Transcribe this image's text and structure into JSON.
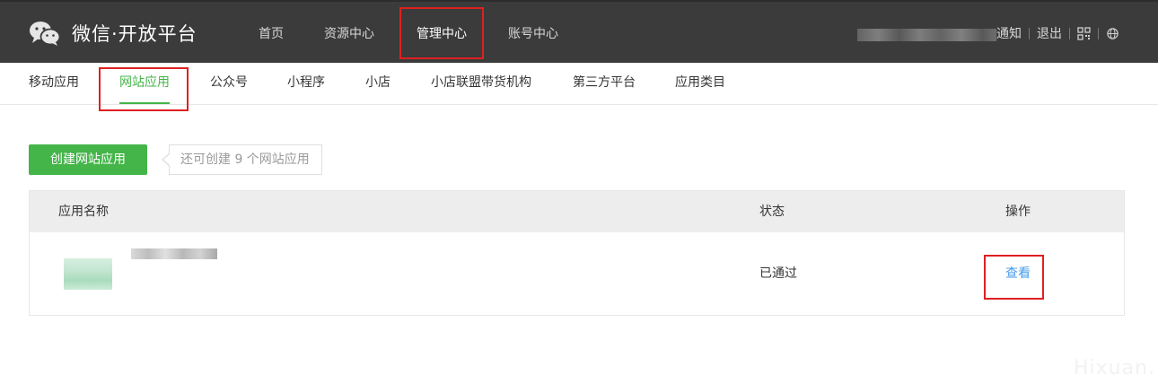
{
  "brand": {
    "title": "微信·开放平台"
  },
  "top_nav": [
    {
      "label": "首页"
    },
    {
      "label": "资源中心"
    },
    {
      "label": "管理中心",
      "active": true
    },
    {
      "label": "账号中心"
    }
  ],
  "top_right": {
    "notify": "通知",
    "logout": "退出",
    "icons": [
      "qrcode-icon",
      "globe-icon"
    ]
  },
  "sub_nav": [
    {
      "label": "移动应用"
    },
    {
      "label": "网站应用",
      "active": true
    },
    {
      "label": "公众号"
    },
    {
      "label": "小程序"
    },
    {
      "label": "小店"
    },
    {
      "label": "小店联盟带货机构"
    },
    {
      "label": "第三方平台"
    },
    {
      "label": "应用类目"
    }
  ],
  "actions": {
    "create_button": "创建网站应用",
    "tip": "还可创建 9 个网站应用"
  },
  "table": {
    "headers": {
      "name": "应用名称",
      "status": "状态",
      "operation": "操作"
    },
    "rows": [
      {
        "status": "已通过",
        "action": "查看"
      }
    ]
  },
  "watermark": "Hixuan.",
  "colors": {
    "topbar": "#3b3b3b",
    "accent": "#44b549",
    "link": "#459ae9",
    "annotation": "#e02020"
  }
}
